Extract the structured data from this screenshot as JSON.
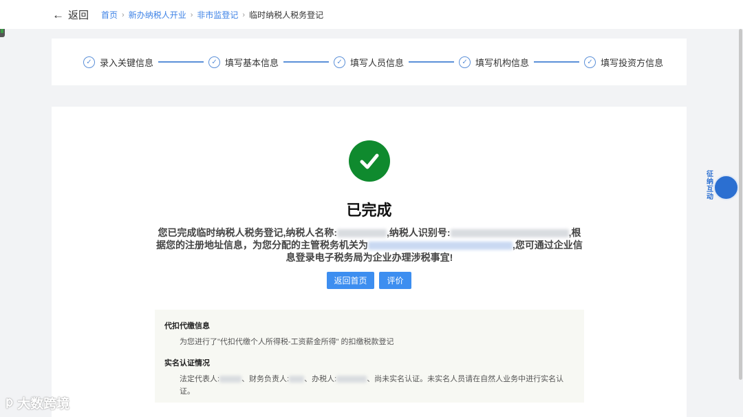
{
  "header": {
    "back_label": "返回",
    "breadcrumb": [
      "首页",
      "新办纳税人开业",
      "非市监登记",
      "临时纳税人税务登记"
    ]
  },
  "steps": [
    "录入关键信息",
    "填写基本信息",
    "填写人员信息",
    "填写机构信息",
    "填写投资方信息"
  ],
  "result": {
    "title": "已完成",
    "message_part1": "您已完成临时纳税人税务登记,纳税人名称:",
    "message_part2": ",纳税人识别号:",
    "message_part3": ",根据您的注册地址信息，为您分配的主管税务机关为",
    "message_part4": ",您可通过企业信息登录电子税务局为企业办理涉税事宜!",
    "home_button": "返回首页",
    "rate_button": "评价"
  },
  "info": {
    "withholding_title": "代扣代缴信息",
    "withholding_text": "为您进行了\"代扣代缴个人所得税-工资薪金所得\" 的扣缴税款登记",
    "realname_title": "实名认证情况",
    "realname_legal_label": "法定代表人:",
    "realname_finance_label": "、财务负责人:",
    "realname_taxpayer_label": "、办税人:",
    "realname_tail": "、尚未实名认证。未实名人员请在自然人业务中进行实名认证。"
  },
  "floating_widget": {
    "label": "征纳互动"
  },
  "watermark": {
    "text": "大数跨境"
  },
  "colors": {
    "accent": "#3d8ef0",
    "success": "#0f8a2e",
    "step_line": "#5a8fd8"
  }
}
